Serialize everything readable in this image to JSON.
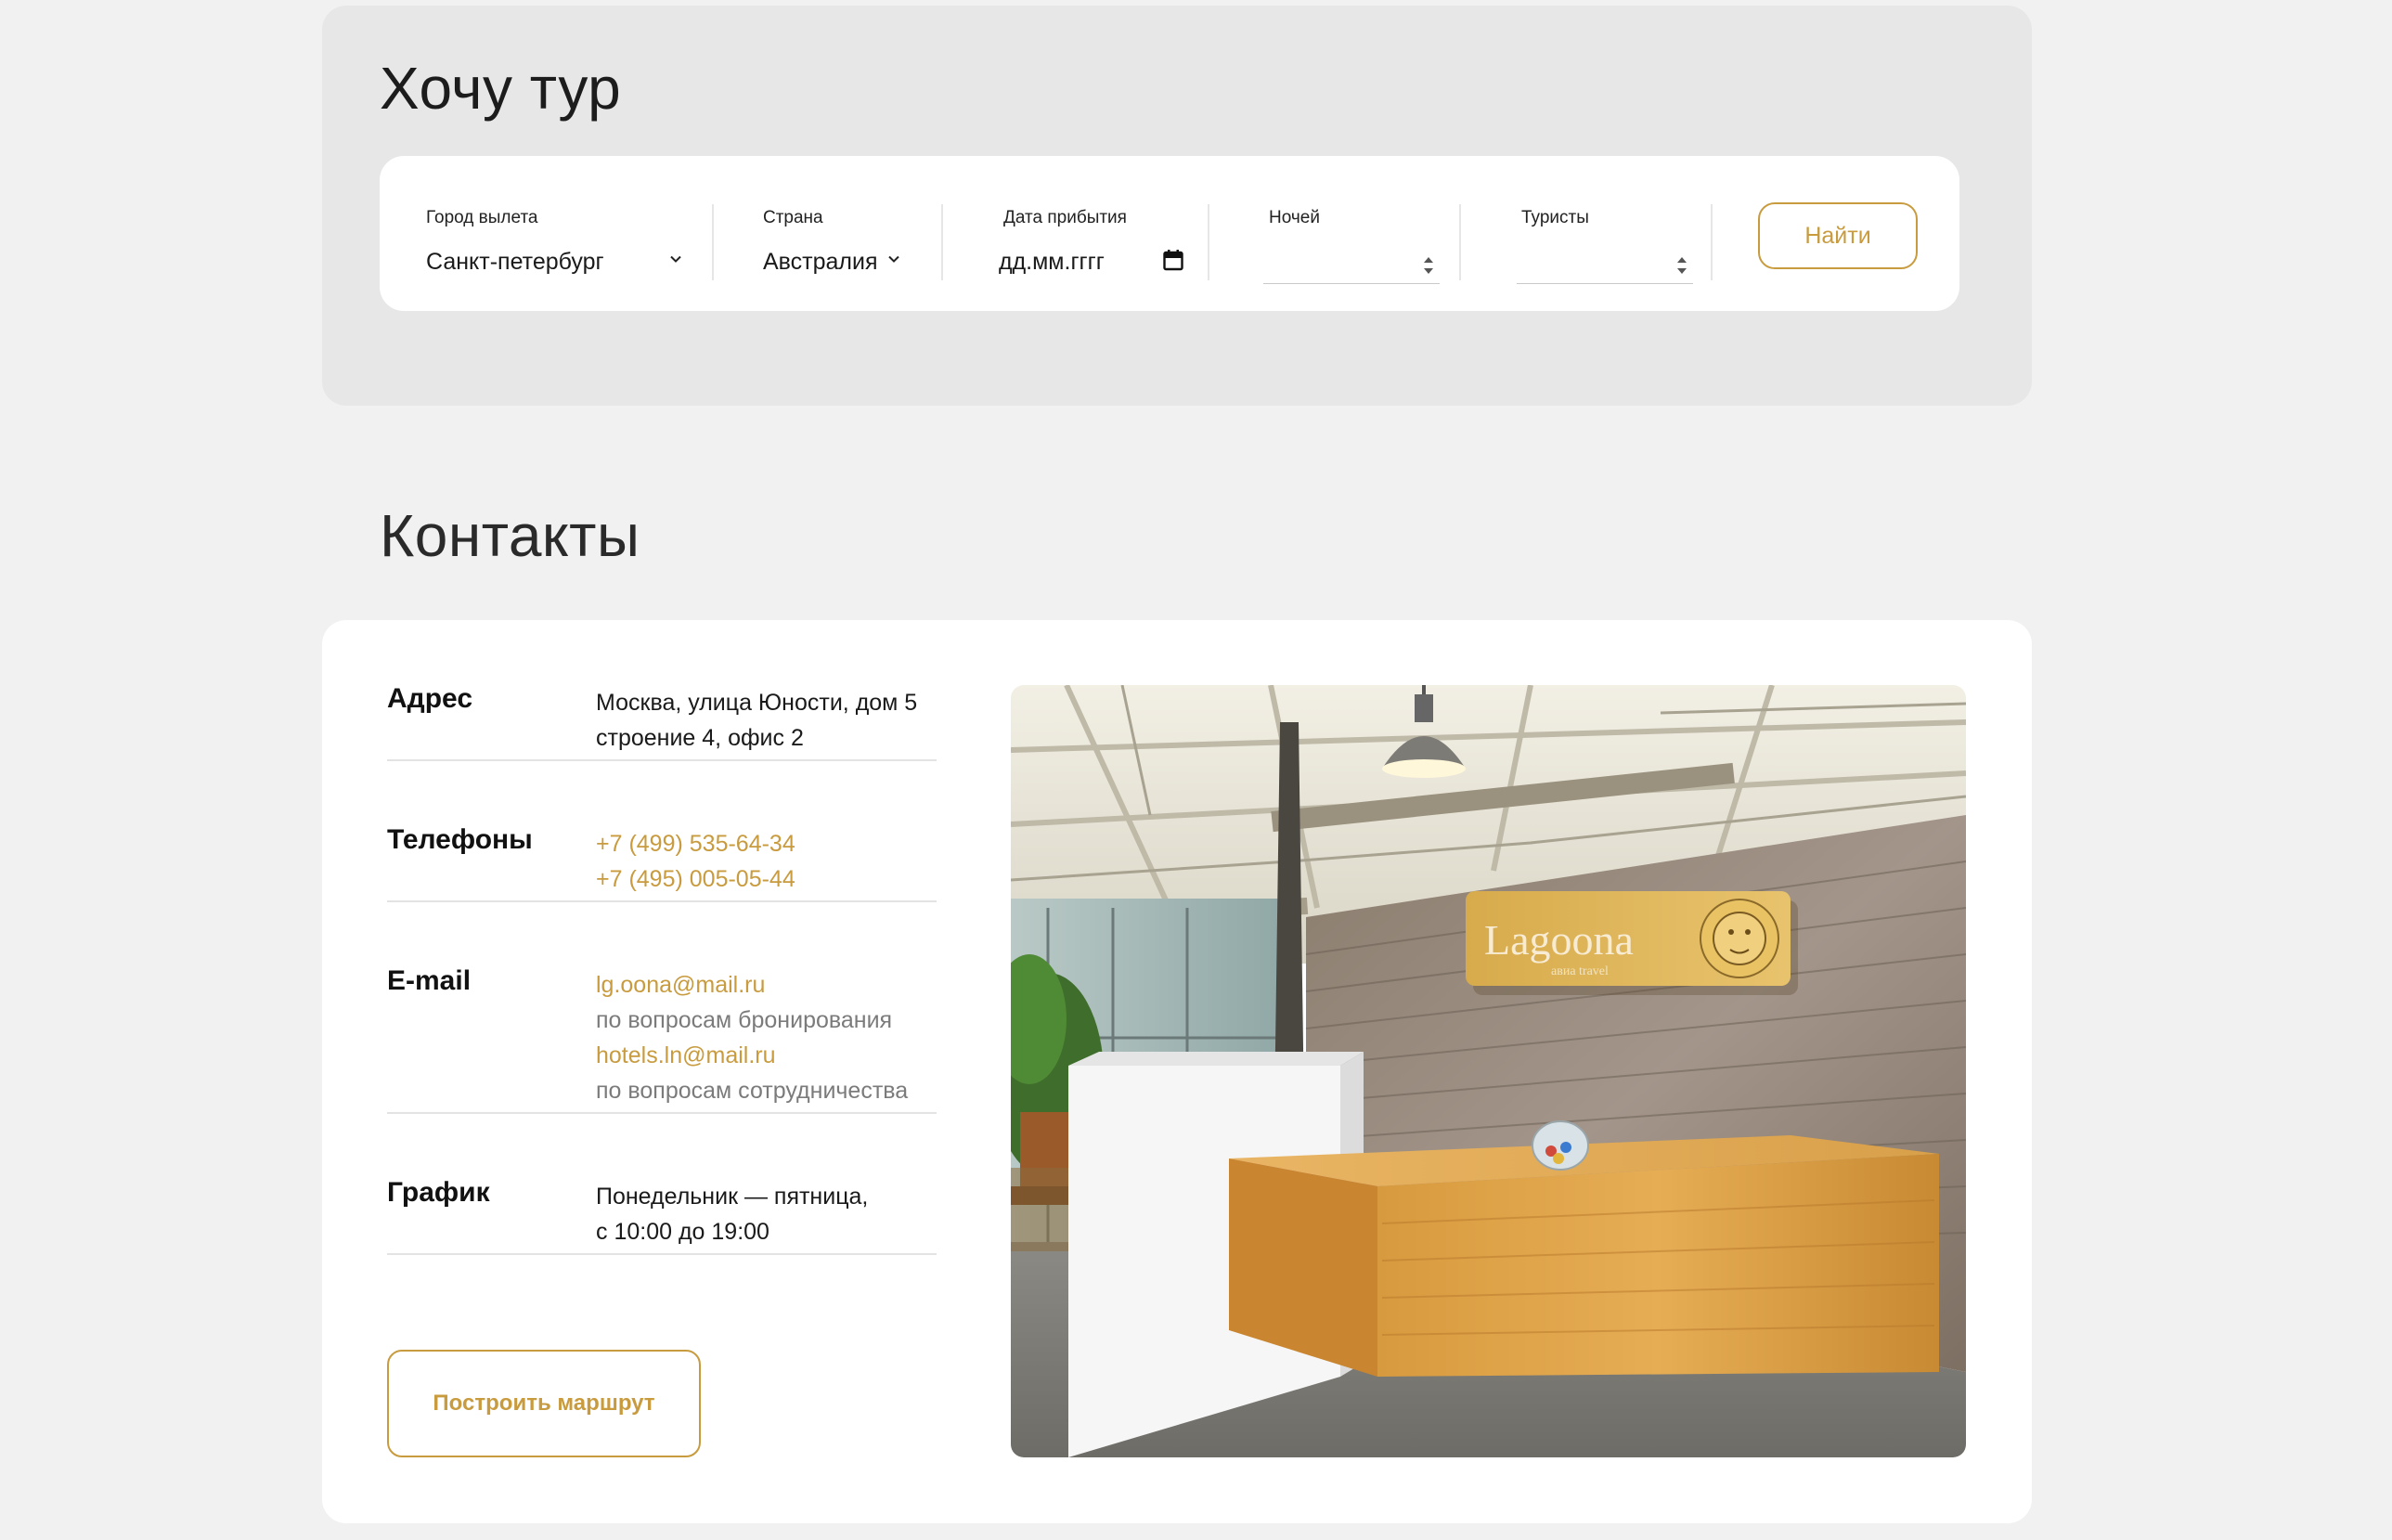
{
  "tour": {
    "title": "Хочу тур",
    "fields": {
      "departure_city": {
        "label": "Город вылета",
        "value": "Санкт-петербург"
      },
      "country": {
        "label": "Страна",
        "value": "Австралия"
      },
      "arrival_date": {
        "label": "Дата прибытия",
        "placeholder": "дд.мм.гггг"
      },
      "nights": {
        "label": "Ночей",
        "value": ""
      },
      "tourists": {
        "label": "Туристы",
        "value": ""
      }
    },
    "find_button": "Найти"
  },
  "contacts": {
    "title": "Контакты",
    "address": {
      "label": "Адрес",
      "lines": [
        "Москва, улица Юности, дом 5",
        "строение 4, офис 2"
      ]
    },
    "phones": {
      "label": "Телефоны",
      "lines": [
        "+7 (499) 535-64-34",
        "+7 (495) 005-05-44"
      ]
    },
    "email": {
      "label": "E-mail",
      "entries": [
        {
          "address": "lg.oona@mail.ru",
          "note": "по вопросам бронирования"
        },
        {
          "address": "hotels.ln@mail.ru",
          "note": "по вопросам сотрудничества"
        }
      ]
    },
    "schedule": {
      "label": "График",
      "lines": [
        "Понедельник — пятница,",
        "с 10:00 до 19:00"
      ]
    },
    "route_button": "Построить маршрут",
    "photo_sign": {
      "brand": "Lagoona",
      "tagline": "авиа travel"
    }
  },
  "colors": {
    "accent": "#c89b3f",
    "page_bg": "#f1f1f1",
    "panel_bg": "#e7e7e7",
    "card_bg": "#ffffff",
    "muted_text": "#7b7b7b"
  }
}
